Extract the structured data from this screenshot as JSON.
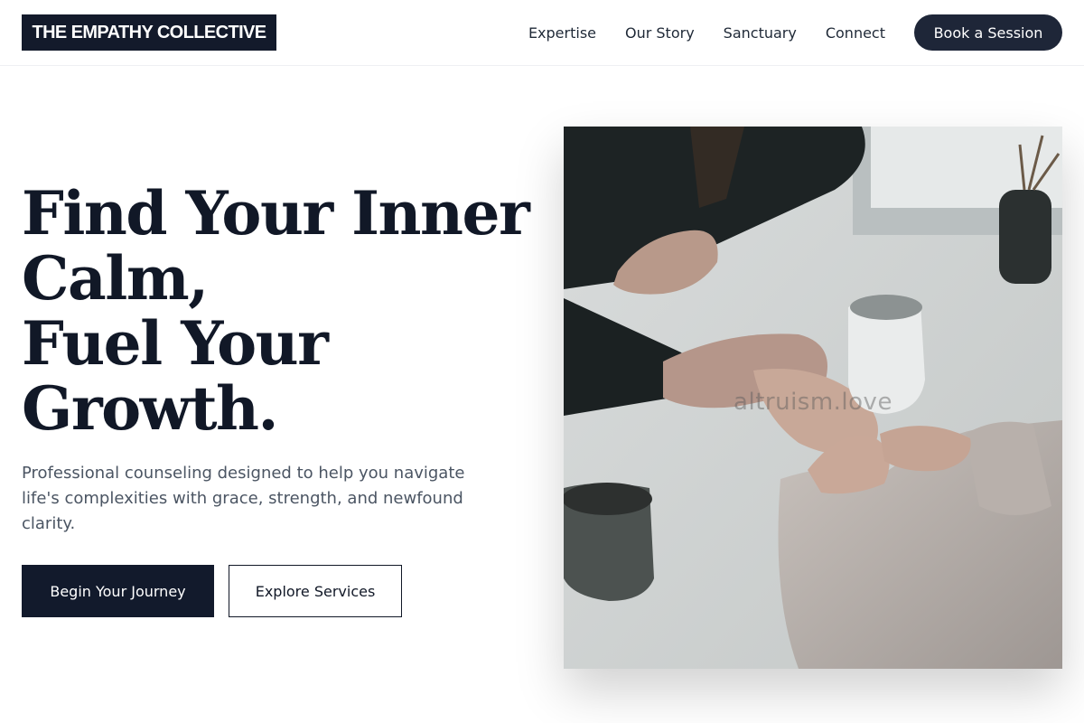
{
  "brand": {
    "logo_text": "THE EMPATHY COLLECTIVE"
  },
  "nav": {
    "links": [
      "Expertise",
      "Our Story",
      "Sanctuary",
      "Connect"
    ],
    "cta": "Book a Session"
  },
  "hero": {
    "headline_lines": [
      "Find Your Inner",
      "Calm,",
      "Fuel Your",
      "Growth."
    ],
    "subtext": "Professional counseling designed to help you navigate life's complexities with grace, strength, and newfound clarity.",
    "primary_button": "Begin Your Journey",
    "secondary_button": "Explore Services",
    "image_watermark": "altruism.love"
  },
  "colors": {
    "navy": "#131a2b",
    "button_dark": "#1e2638",
    "text_muted": "#4b5563"
  }
}
